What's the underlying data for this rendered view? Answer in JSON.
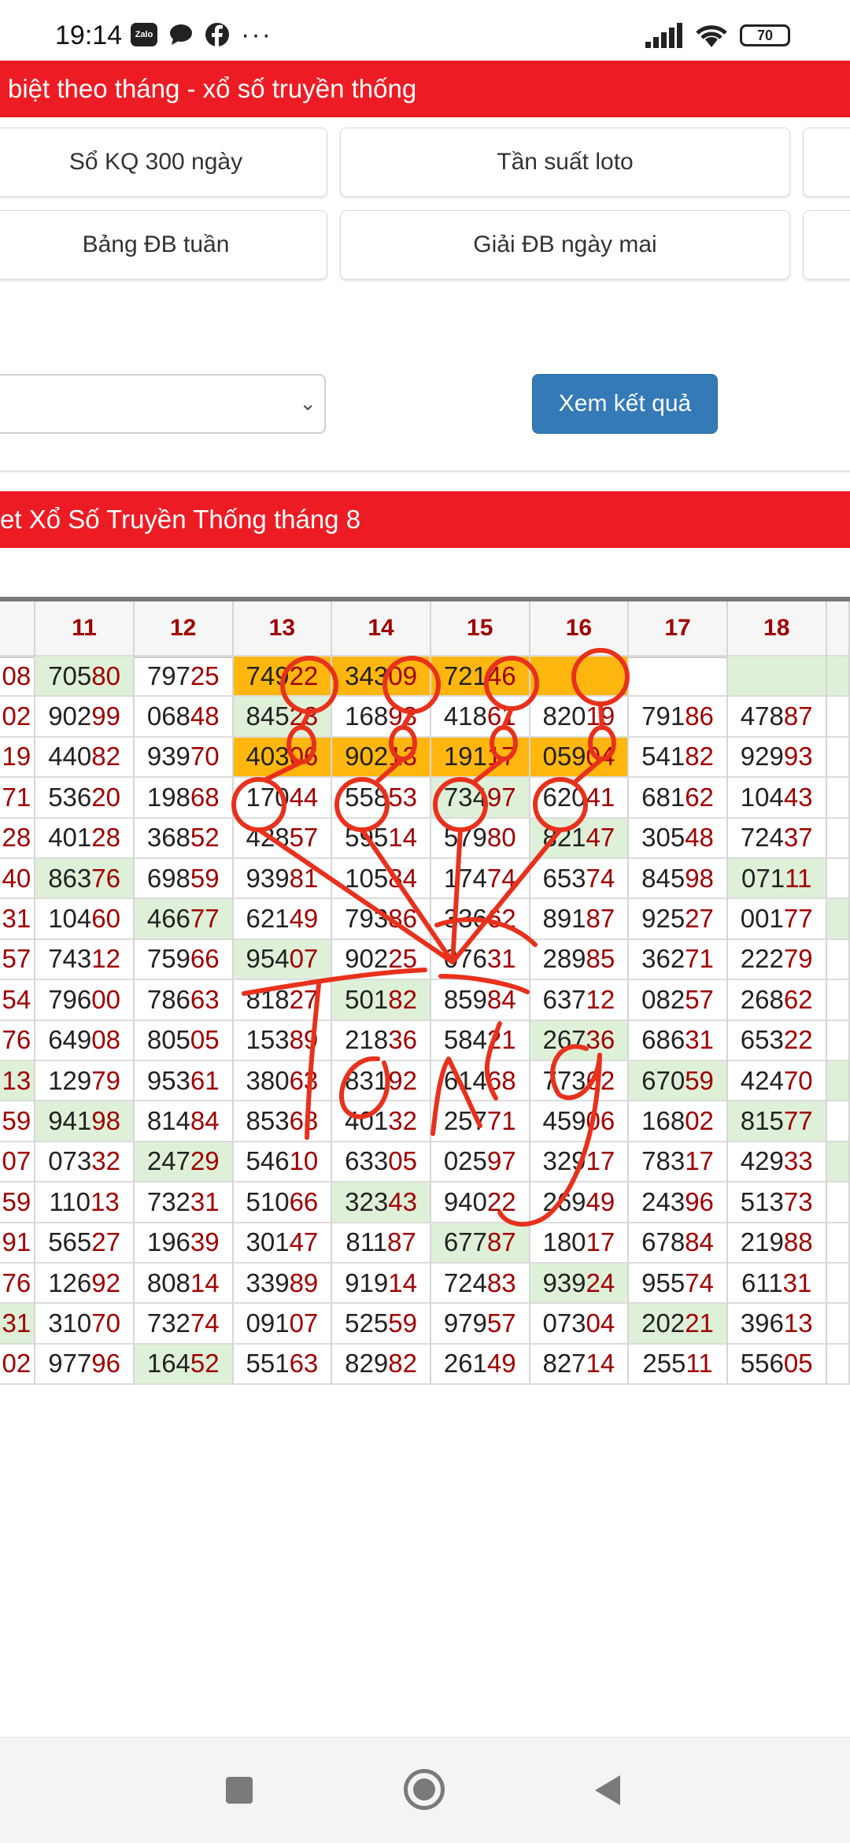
{
  "status_bar": {
    "time": "19:14",
    "apps": [
      "Zalo",
      "chat-bubble-icon",
      "facebook-icon"
    ],
    "more": "···",
    "battery": "70"
  },
  "header1": {
    "text": "biệt theo tháng - xổ số truyền thống"
  },
  "links": {
    "row1": [
      "Sổ KQ 300 ngày",
      "Tần suất loto"
    ],
    "row2": [
      "Bảng ĐB tuần",
      "Giải ĐB ngày mai"
    ]
  },
  "form": {
    "select_value": "",
    "button_label": "Xem kết quả"
  },
  "header2": {
    "text": "et Xổ Số Truyền Thống tháng 8"
  },
  "table": {
    "headers": [
      "11",
      "12",
      "13",
      "14",
      "15",
      "16",
      "17",
      "18"
    ],
    "rows": [
      {
        "edge": "08",
        "cells": [
          [
            "705",
            "80",
            "g"
          ],
          [
            "797",
            "25",
            ""
          ],
          [
            "749",
            "22",
            "o"
          ],
          [
            "343",
            "09",
            "o"
          ],
          [
            "721",
            "46",
            "o"
          ],
          [
            "",
            "",
            "o"
          ],
          [
            "",
            "",
            ""
          ],
          [
            "",
            "",
            "g"
          ]
        ],
        "last": "g"
      },
      {
        "edge": "02",
        "cells": [
          [
            "902",
            "99",
            ""
          ],
          [
            "068",
            "48",
            ""
          ],
          [
            "845",
            "23",
            "g"
          ],
          [
            "168",
            "93",
            ""
          ],
          [
            "418",
            "61",
            ""
          ],
          [
            "820",
            "19",
            ""
          ],
          [
            "791",
            "86",
            ""
          ],
          [
            "478",
            "87",
            ""
          ]
        ],
        "last": ""
      },
      {
        "edge": "19",
        "cells": [
          [
            "440",
            "82",
            ""
          ],
          [
            "939",
            "70",
            ""
          ],
          [
            "403",
            "06",
            "o"
          ],
          [
            "902",
            "13",
            "o"
          ],
          [
            "191",
            "17",
            "o"
          ],
          [
            "059",
            "04",
            "o"
          ],
          [
            "541",
            "82",
            ""
          ],
          [
            "929",
            "93",
            ""
          ]
        ],
        "last": ""
      },
      {
        "edge": "71",
        "cells": [
          [
            "536",
            "20",
            ""
          ],
          [
            "198",
            "68",
            ""
          ],
          [
            "170",
            "44",
            ""
          ],
          [
            "558",
            "53",
            ""
          ],
          [
            "734",
            "97",
            "g"
          ],
          [
            "620",
            "41",
            ""
          ],
          [
            "681",
            "62",
            ""
          ],
          [
            "104",
            "43",
            ""
          ]
        ],
        "last": ""
      },
      {
        "edge": "28",
        "cells": [
          [
            "401",
            "28",
            ""
          ],
          [
            "368",
            "52",
            ""
          ],
          [
            "428",
            "57",
            ""
          ],
          [
            "595",
            "14",
            ""
          ],
          [
            "579",
            "80",
            ""
          ],
          [
            "821",
            "47",
            "g"
          ],
          [
            "305",
            "48",
            ""
          ],
          [
            "724",
            "37",
            ""
          ]
        ],
        "last": ""
      },
      {
        "edge": "40",
        "cells": [
          [
            "863",
            "76",
            "g"
          ],
          [
            "698",
            "59",
            ""
          ],
          [
            "939",
            "81",
            ""
          ],
          [
            "105",
            "84",
            ""
          ],
          [
            "174",
            "74",
            ""
          ],
          [
            "653",
            "74",
            ""
          ],
          [
            "845",
            "98",
            ""
          ],
          [
            "071",
            "11",
            "g"
          ]
        ],
        "last": ""
      },
      {
        "edge": "31",
        "cells": [
          [
            "104",
            "60",
            ""
          ],
          [
            "466",
            "77",
            "g"
          ],
          [
            "621",
            "49",
            ""
          ],
          [
            "793",
            "86",
            ""
          ],
          [
            "336",
            "62",
            ""
          ],
          [
            "891",
            "87",
            ""
          ],
          [
            "925",
            "27",
            ""
          ],
          [
            "001",
            "77",
            ""
          ]
        ],
        "last": "g"
      },
      {
        "edge": "57",
        "cells": [
          [
            "743",
            "12",
            ""
          ],
          [
            "759",
            "66",
            ""
          ],
          [
            "954",
            "07",
            "g"
          ],
          [
            "902",
            "25",
            ""
          ],
          [
            "076",
            "31",
            ""
          ],
          [
            "289",
            "85",
            ""
          ],
          [
            "362",
            "71",
            ""
          ],
          [
            "222",
            "79",
            ""
          ]
        ],
        "last": ""
      },
      {
        "edge": "54",
        "cells": [
          [
            "796",
            "00",
            ""
          ],
          [
            "786",
            "63",
            ""
          ],
          [
            "818",
            "27",
            ""
          ],
          [
            "501",
            "82",
            "g"
          ],
          [
            "859",
            "84",
            ""
          ],
          [
            "637",
            "12",
            ""
          ],
          [
            "082",
            "57",
            ""
          ],
          [
            "268",
            "62",
            ""
          ]
        ],
        "last": ""
      },
      {
        "edge": "76",
        "cells": [
          [
            "649",
            "08",
            ""
          ],
          [
            "805",
            "05",
            ""
          ],
          [
            "153",
            "89",
            ""
          ],
          [
            "218",
            "36",
            ""
          ],
          [
            "584",
            "21",
            ""
          ],
          [
            "267",
            "36",
            "g"
          ],
          [
            "686",
            "31",
            ""
          ],
          [
            "653",
            "22",
            ""
          ]
        ],
        "last": ""
      },
      {
        "edge": "13",
        "cells": [
          [
            "129",
            "79",
            ""
          ],
          [
            "953",
            "61",
            ""
          ],
          [
            "380",
            "63",
            ""
          ],
          [
            "831",
            "92",
            ""
          ],
          [
            "614",
            "68",
            ""
          ],
          [
            "773",
            "62",
            ""
          ],
          [
            "670",
            "59",
            "g"
          ],
          [
            "424",
            "70",
            ""
          ]
        ],
        "last": "g",
        "edgeg": true
      },
      {
        "edge": "59",
        "cells": [
          [
            "941",
            "98",
            "g"
          ],
          [
            "814",
            "84",
            ""
          ],
          [
            "853",
            "68",
            ""
          ],
          [
            "401",
            "32",
            ""
          ],
          [
            "257",
            "71",
            ""
          ],
          [
            "459",
            "06",
            ""
          ],
          [
            "168",
            "02",
            ""
          ],
          [
            "815",
            "77",
            "g"
          ]
        ],
        "last": ""
      },
      {
        "edge": "07",
        "cells": [
          [
            "073",
            "32",
            ""
          ],
          [
            "247",
            "29",
            "g"
          ],
          [
            "546",
            "10",
            ""
          ],
          [
            "633",
            "05",
            ""
          ],
          [
            "025",
            "97",
            ""
          ],
          [
            "329",
            "17",
            ""
          ],
          [
            "783",
            "17",
            ""
          ],
          [
            "429",
            "33",
            ""
          ]
        ],
        "last": "g"
      },
      {
        "edge": "59",
        "cells": [
          [
            "110",
            "13",
            ""
          ],
          [
            "732",
            "31",
            ""
          ],
          [
            "510",
            "66",
            ""
          ],
          [
            "323",
            "43",
            "g"
          ],
          [
            "940",
            "22",
            ""
          ],
          [
            "269",
            "49",
            ""
          ],
          [
            "243",
            "96",
            ""
          ],
          [
            "513",
            "73",
            ""
          ]
        ],
        "last": ""
      },
      {
        "edge": "91",
        "cells": [
          [
            "565",
            "27",
            ""
          ],
          [
            "196",
            "39",
            ""
          ],
          [
            "301",
            "47",
            ""
          ],
          [
            "811",
            "87",
            ""
          ],
          [
            "677",
            "87",
            "g"
          ],
          [
            "180",
            "17",
            ""
          ],
          [
            "678",
            "84",
            ""
          ],
          [
            "219",
            "88",
            ""
          ]
        ],
        "last": ""
      },
      {
        "edge": "76",
        "cells": [
          [
            "126",
            "92",
            ""
          ],
          [
            "808",
            "14",
            ""
          ],
          [
            "339",
            "89",
            ""
          ],
          [
            "919",
            "14",
            ""
          ],
          [
            "724",
            "83",
            ""
          ],
          [
            "939",
            "24",
            "g"
          ],
          [
            "955",
            "74",
            ""
          ],
          [
            "611",
            "31",
            ""
          ]
        ],
        "last": ""
      },
      {
        "edge": "31",
        "cells": [
          [
            "310",
            "70",
            ""
          ],
          [
            "732",
            "74",
            ""
          ],
          [
            "091",
            "07",
            ""
          ],
          [
            "525",
            "59",
            ""
          ],
          [
            "979",
            "57",
            ""
          ],
          [
            "073",
            "04",
            ""
          ],
          [
            "202",
            "21",
            "g"
          ],
          [
            "396",
            "13",
            ""
          ]
        ],
        "last": "",
        "edgeg": true
      },
      {
        "edge": "02",
        "cells": [
          [
            "977",
            "96",
            ""
          ],
          [
            "164",
            "52",
            "g"
          ],
          [
            "551",
            "63",
            ""
          ],
          [
            "829",
            "82",
            ""
          ],
          [
            "261",
            "49",
            ""
          ],
          [
            "827",
            "14",
            ""
          ],
          [
            "255",
            "11",
            ""
          ],
          [
            "556",
            "05",
            ""
          ]
        ],
        "last": ""
      }
    ]
  },
  "annotation": {
    "handwritten_text": "Tổng",
    "color": "#e8311c"
  },
  "colors": {
    "red": "#ed1c24",
    "button_blue": "#337ab7",
    "highlight_orange": "#ffb70f",
    "highlight_green": "#dff0d8",
    "digit_red": "#a00000"
  },
  "nav": {
    "icons": [
      "recent-apps-icon",
      "home-icon",
      "back-icon"
    ]
  }
}
